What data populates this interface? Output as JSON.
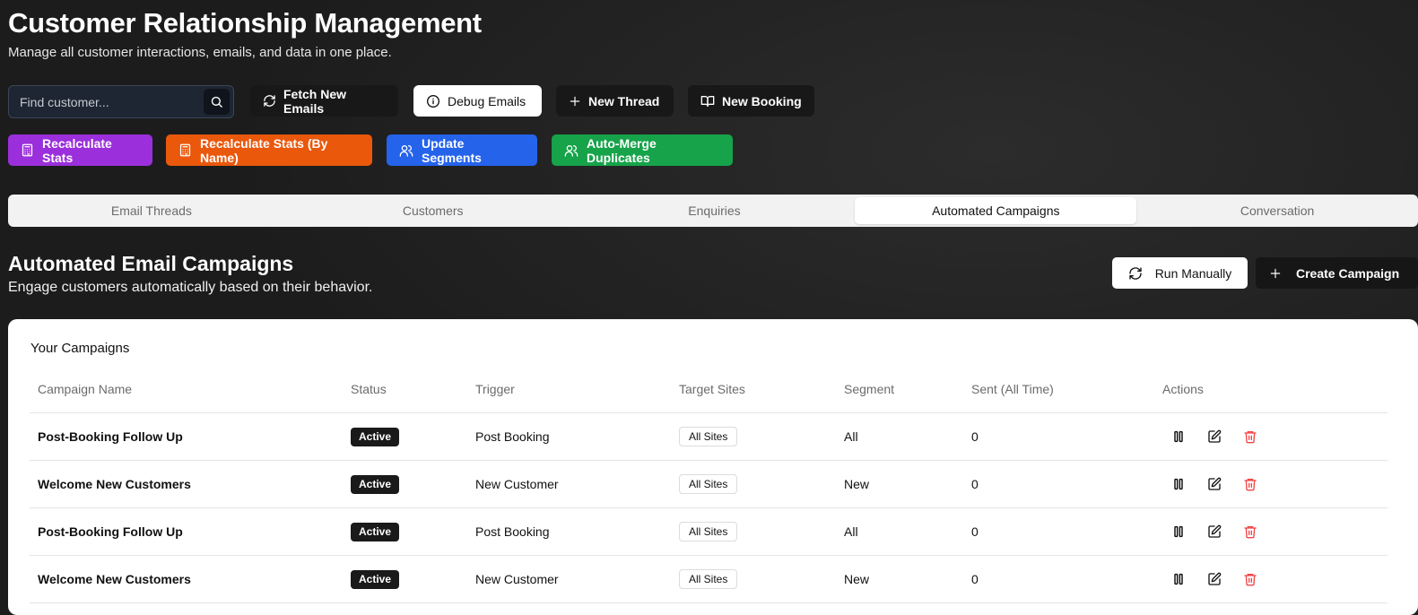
{
  "header": {
    "title": "Customer Relationship Management",
    "subtitle": "Manage all customer interactions, emails, and data in one place."
  },
  "search": {
    "placeholder": "Find customer...",
    "value": ""
  },
  "toolbar": {
    "fetch_emails": "Fetch New Emails",
    "debug_emails": "Debug Emails",
    "new_thread": "New Thread",
    "new_booking": "New Booking"
  },
  "actions": {
    "recalc": {
      "label": "Recalculate Stats",
      "color": "#9b2fdb"
    },
    "recalc_name": {
      "label": "Recalculate Stats (By Name)",
      "color": "#ea580c"
    },
    "update_segments": {
      "label": "Update Segments",
      "color": "#2563eb"
    },
    "auto_merge": {
      "label": "Auto-Merge Duplicates",
      "color": "#16a34a"
    }
  },
  "tabs": [
    {
      "label": "Email Threads",
      "active": false
    },
    {
      "label": "Customers",
      "active": false
    },
    {
      "label": "Enquiries",
      "active": false
    },
    {
      "label": "Automated Campaigns",
      "active": true
    },
    {
      "label": "Conversation",
      "active": false
    }
  ],
  "section": {
    "title": "Automated Email Campaigns",
    "subtitle": "Engage customers automatically based on their behavior.",
    "run_manually": "Run Manually",
    "create_campaign": "Create Campaign"
  },
  "campaigns": {
    "title": "Your Campaigns",
    "columns": [
      "Campaign Name",
      "Status",
      "Trigger",
      "Target Sites",
      "Segment",
      "Sent (All Time)",
      "Actions"
    ],
    "rows": [
      {
        "name": "Post-Booking Follow Up",
        "status": "Active",
        "trigger": "Post Booking",
        "sites": "All Sites",
        "segment": "All",
        "sent": "0"
      },
      {
        "name": "Welcome New Customers",
        "status": "Active",
        "trigger": "New Customer",
        "sites": "All Sites",
        "segment": "New",
        "sent": "0"
      },
      {
        "name": "Post-Booking Follow Up",
        "status": "Active",
        "trigger": "Post Booking",
        "sites": "All Sites",
        "segment": "All",
        "sent": "0"
      },
      {
        "name": "Welcome New Customers",
        "status": "Active",
        "trigger": "New Customer",
        "sites": "All Sites",
        "segment": "New",
        "sent": "0"
      }
    ],
    "row_actions": [
      "pause-icon",
      "edit-icon",
      "delete-icon"
    ]
  }
}
